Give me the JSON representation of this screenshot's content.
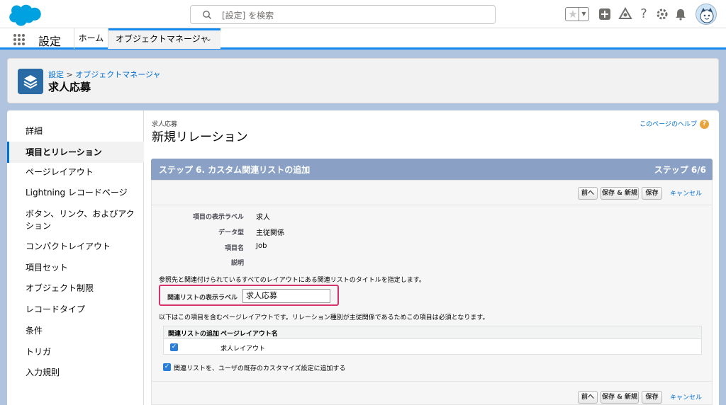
{
  "header": {
    "search_placeholder": "[設定] を検索",
    "icons": [
      "favorites-star-icon",
      "favorites-dropdown-icon",
      "add-icon",
      "trailhead-icon",
      "help-icon",
      "setup-gear-icon",
      "notifications-bell-icon",
      "avatar"
    ]
  },
  "nav": {
    "app_name": "設定",
    "tabs": [
      {
        "label": "ホーム"
      },
      {
        "label": "オブジェクトマネージャ"
      }
    ]
  },
  "page_header": {
    "breadcrumb_setup": "設定",
    "breadcrumb_sep": ">",
    "breadcrumb_om": "オブジェクトマネージャ",
    "title": "求人応募"
  },
  "sidebar": {
    "items": [
      {
        "label": "詳細"
      },
      {
        "label": "項目とリレーション"
      },
      {
        "label": "ページレイアウト"
      },
      {
        "label": "Lightning レコードページ"
      },
      {
        "label": "ボタン、リンク、およびアクション"
      },
      {
        "label": "コンパクトレイアウト"
      },
      {
        "label": "項目セット"
      },
      {
        "label": "オブジェクト制限"
      },
      {
        "label": "レコードタイプ"
      },
      {
        "label": "条件"
      },
      {
        "label": "トリガ"
      },
      {
        "label": "入力規則"
      }
    ],
    "active": "項目とリレーション"
  },
  "content": {
    "object_label": "求人応募",
    "title": "新規リレーション",
    "help_link": "このページのヘルプ",
    "step_title": "ステップ 6. カスタム関連リストの追加",
    "step_count": "ステップ 6/6",
    "buttons": {
      "prev": "前へ",
      "save_new": "保存 & 新規",
      "save": "保存",
      "cancel": "キャンセル"
    },
    "fields": [
      {
        "label": "項目の表示ラベル",
        "value": "求人"
      },
      {
        "label": "データ型",
        "value": "主従関係"
      },
      {
        "label": "項目名",
        "value": "Job"
      },
      {
        "label": "説明",
        "value": ""
      }
    ],
    "instruction1": "参照先と関連付けられているすべてのレイアウトにある関連リストのタイトルを指定します。",
    "related_list_label": "関連リストの表示ラベル",
    "related_list_value": "求人応募",
    "instruction2": "以下はこの項目を含むページレイアウトです。リレーション種別が主従関係であるためこの項目は必須となります。",
    "table": {
      "col_add": "関連リストの追加",
      "col_layout": "ページレイアウト名",
      "rows": [
        {
          "checked": true,
          "layout": "求人レイアウト"
        }
      ]
    },
    "append_checkbox_label": "関連リストを、ユーザの既存のカスタマイズ設定に追加する",
    "append_checked": true
  },
  "colors": {
    "brand": "#1589ee",
    "step_bar": "#8aa1c5",
    "highlight_box": "#d6336c",
    "link": "#0070d2"
  }
}
